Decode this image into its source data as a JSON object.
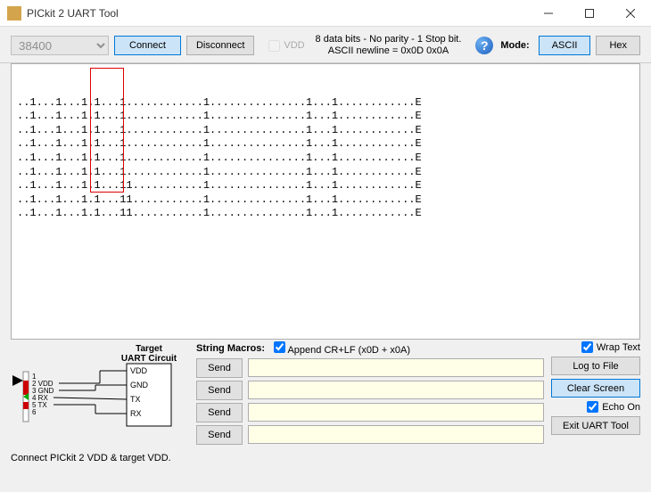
{
  "title": "PICkit 2 UART Tool",
  "toolbar": {
    "baud_rate": "38400",
    "connect_label": "Connect",
    "disconnect_label": "Disconnect",
    "vdd_label": "VDD",
    "info_line1": "8 data bits - No parity - 1 Stop bit.",
    "info_line2": "ASCII newline = 0x0D 0x0A",
    "mode_label": "Mode:",
    "ascii_label": "ASCII",
    "hex_label": "Hex"
  },
  "terminal_lines": [
    "..1...1...1.1...1............1...............1...1............E",
    "..1...1...1.1...1............1...............1...1............E",
    "..1...1...1.1...1............1...............1...1............E",
    "..1...1...1.1...1............1...............1...1............E",
    "..1...1...1.1...1............1...............1...1............E",
    "..1...1...1.1...1............1...............1...1............E",
    "..1...1...1.1...11...........1...............1...1............E",
    "..1...1...1.1...11...........1...............1...1............E",
    "..1...1...1.1...11...........1...............1...1............E"
  ],
  "circuit": {
    "title1": "Target",
    "title2": "UART Circuit",
    "pins": [
      "1",
      "2 VDD",
      "3 GND",
      "4 RX",
      "5 TX",
      "6"
    ],
    "targets": [
      "VDD",
      "GND",
      "TX",
      "RX"
    ]
  },
  "macros": {
    "header_label": "String Macros:",
    "append_label": "Append CR+LF (x0D + x0A)",
    "send_label": "Send",
    "values": [
      "",
      "",
      "",
      ""
    ]
  },
  "right": {
    "wrap_label": "Wrap Text",
    "log_label": "Log to File",
    "clear_label": "Clear Screen",
    "echo_label": "Echo On",
    "exit_label": "Exit UART Tool"
  },
  "status": "Connect PICkit 2 VDD & target VDD."
}
